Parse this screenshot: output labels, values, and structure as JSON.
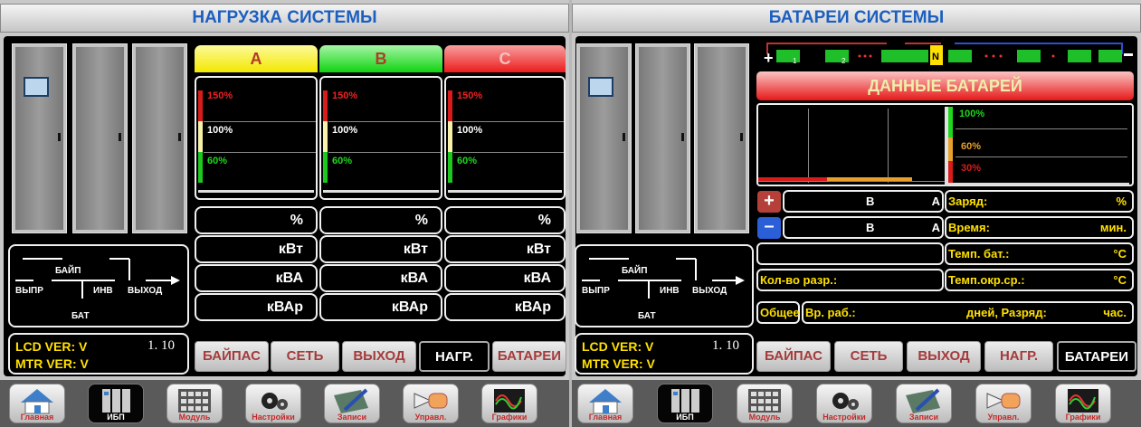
{
  "load": {
    "title": "НАГРУЗКА СИСТЕМЫ",
    "phases": [
      {
        "name": "A",
        "color": "#f5ee1a",
        "pct_unit": "%",
        "kw_unit": "кВт",
        "kva_unit": "кВА",
        "kvar_unit": "кВАр"
      },
      {
        "name": "B",
        "color": "#1ed81e",
        "pct_unit": "%",
        "kw_unit": "кВт",
        "kva_unit": "кВА",
        "kvar_unit": "кВАр"
      },
      {
        "name": "C",
        "color": "#f22a2a",
        "pct_unit": "%",
        "kw_unit": "кВт",
        "kva_unit": "кВА",
        "kvar_unit": "кВАр"
      }
    ],
    "levels": {
      "l150": "150%",
      "l100": "100%",
      "l60": "60%"
    }
  },
  "mimic": {
    "bypass": "БАЙП",
    "rectifier": "ВЫПР",
    "inverter": "ИНВ",
    "output": "ВЫХОД",
    "battery": "БАТ"
  },
  "version": {
    "lcd_label": "LCD VER: V",
    "lcd_value": "1. 10",
    "mtr_label": "MTR VER: V"
  },
  "tabs": [
    "БАЙПАС",
    "СЕТЬ",
    "ВЫХОД",
    "НАГР.",
    "БАТАРЕИ"
  ],
  "battery": {
    "title": "БАТАРЕИ СИСТЕМЫ",
    "data_title": "ДАННЫЕ БАТАРЕЙ",
    "levels": {
      "l100": "100%",
      "l60": "60%",
      "l30": "30%"
    },
    "chain_neutral": "N",
    "chain_sub1": "1",
    "chain_sub2": "2",
    "plus_row": {
      "v": "В",
      "a": "А"
    },
    "minus_row": {
      "v": "В",
      "a": "А"
    },
    "charge_label": "Заряд:",
    "charge_unit": "%",
    "time_label": "Время:",
    "time_unit": "мин.",
    "temp_bat_label": "Темп. бат.:",
    "temp_bat_unit": "°С",
    "discharges_label": "Кол-во разр.:",
    "temp_env_label": "Темп.окр.ср.:",
    "temp_env_unit": "°С",
    "total_label": "Общее",
    "runtime_label": "Вр. раб.:",
    "days_label": "дней, Разряд:",
    "hours_unit": "час."
  },
  "nav": [
    "Главная",
    "ИБП",
    "Модуль",
    "Настройки",
    "Записи",
    "Управл.",
    "Графики"
  ],
  "left_active_tab": "НАГР.",
  "right_active_tab": "БАТАРЕИ",
  "active_nav": "ИБП"
}
